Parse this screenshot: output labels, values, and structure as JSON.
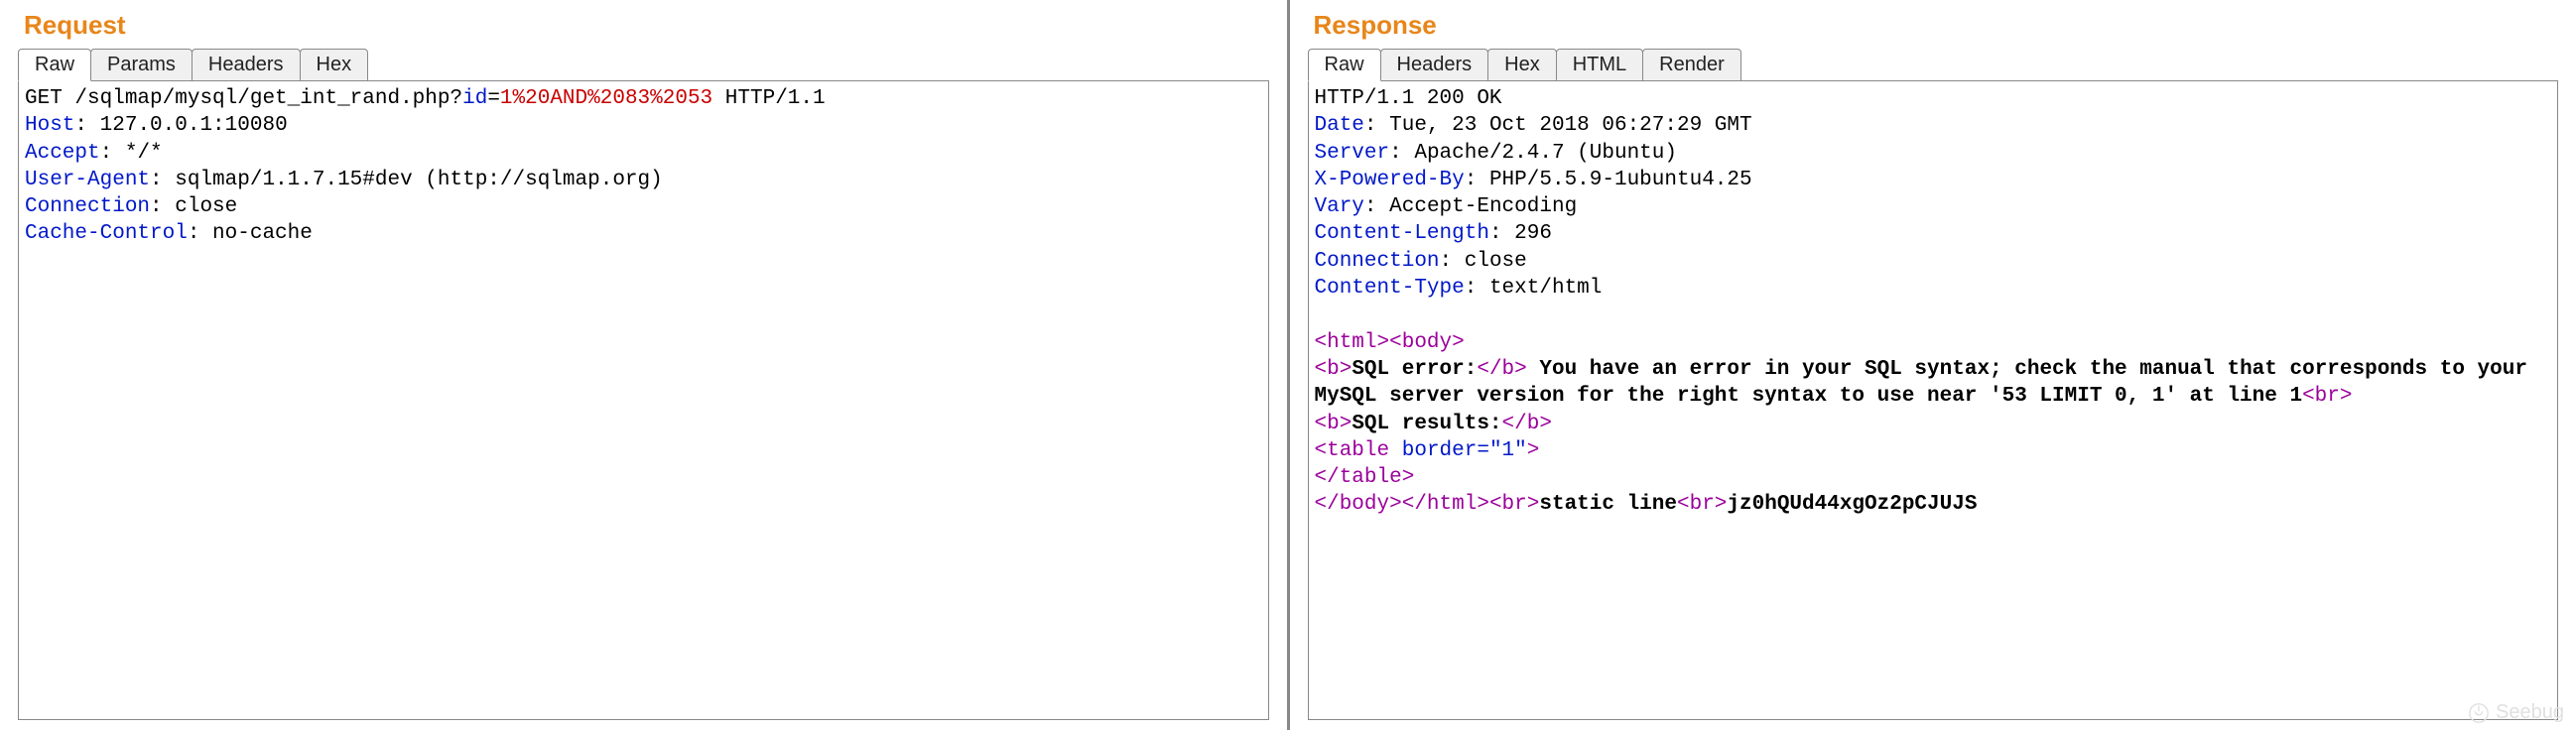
{
  "request": {
    "title": "Request",
    "tabs": [
      {
        "label": "Raw",
        "active": true
      },
      {
        "label": "Params",
        "active": false
      },
      {
        "label": "Headers",
        "active": false
      },
      {
        "label": "Hex",
        "active": false
      }
    ],
    "method": "GET",
    "path": "/sqlmap/mysql/get_int_rand.php",
    "query_param": "id",
    "query_value": "1%20AND%2083%2053",
    "http_version": "HTTP/1.1",
    "headers": [
      {
        "name": "Host",
        "value": "127.0.0.1:10080"
      },
      {
        "name": "Accept",
        "value": "*/*"
      },
      {
        "name": "User-Agent",
        "value": "sqlmap/1.1.7.15#dev (http://sqlmap.org)"
      },
      {
        "name": "Connection",
        "value": "close"
      },
      {
        "name": "Cache-Control",
        "value": "no-cache"
      }
    ]
  },
  "response": {
    "title": "Response",
    "tabs": [
      {
        "label": "Raw",
        "active": true
      },
      {
        "label": "Headers",
        "active": false
      },
      {
        "label": "Hex",
        "active": false
      },
      {
        "label": "HTML",
        "active": false
      },
      {
        "label": "Render",
        "active": false
      }
    ],
    "status_line": "HTTP/1.1 200 OK",
    "headers": [
      {
        "name": "Date",
        "value": "Tue, 23 Oct 2018 06:27:29 GMT"
      },
      {
        "name": "Server",
        "value": "Apache/2.4.7 (Ubuntu)"
      },
      {
        "name": "X-Powered-By",
        "value": "PHP/5.5.9-1ubuntu4.25"
      },
      {
        "name": "Vary",
        "value": "Accept-Encoding"
      },
      {
        "name": "Content-Length",
        "value": "296"
      },
      {
        "name": "Connection",
        "value": "close"
      },
      {
        "name": "Content-Type",
        "value": "text/html"
      }
    ],
    "body_sql_error_label": "SQL error:",
    "body_sql_error_msg": " You have an error in your SQL syntax; check the manual that corresponds to your MySQL server version for the right syntax to use near '53 LIMIT 0, 1' at line 1",
    "body_sql_results_label": "SQL results:",
    "body_table_attr": "border",
    "body_table_attr_val": "\"1\"",
    "body_static_line": "static line",
    "body_trailer": "jz0hQUd44xgOz2pCJUJS"
  },
  "watermark": "Seebug"
}
